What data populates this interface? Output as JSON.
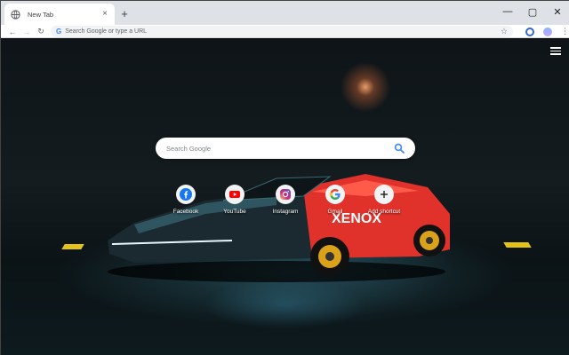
{
  "tab": {
    "title": "New Tab",
    "close": "×"
  },
  "newtab": {
    "label": "+"
  },
  "window_controls": {
    "minimize": "—",
    "maximize": "▢",
    "close": "✕"
  },
  "toolbar": {
    "back": "←",
    "forward": "→",
    "reload": "↻",
    "star": "☆",
    "menu": "⋮"
  },
  "omnibox": {
    "g_letter": "G",
    "placeholder": "Search Google or type a URL"
  },
  "search": {
    "placeholder": "Search Google"
  },
  "shortcuts": [
    {
      "label": "Facebook",
      "icon": "facebook-icon"
    },
    {
      "label": "YouTube",
      "icon": "youtube-icon"
    },
    {
      "label": "Instagram",
      "icon": "instagram-icon"
    },
    {
      "label": "Gmail",
      "icon": "google-icon"
    },
    {
      "label": "Add shortcut",
      "icon": "plus-icon"
    }
  ],
  "car": {
    "decal": "XENOX"
  },
  "colors": {
    "tabstrip": "#dee1e6",
    "car_red": "#e0322b",
    "accent_yellow": "#e3c21a",
    "google_blue": "#4285f4"
  }
}
